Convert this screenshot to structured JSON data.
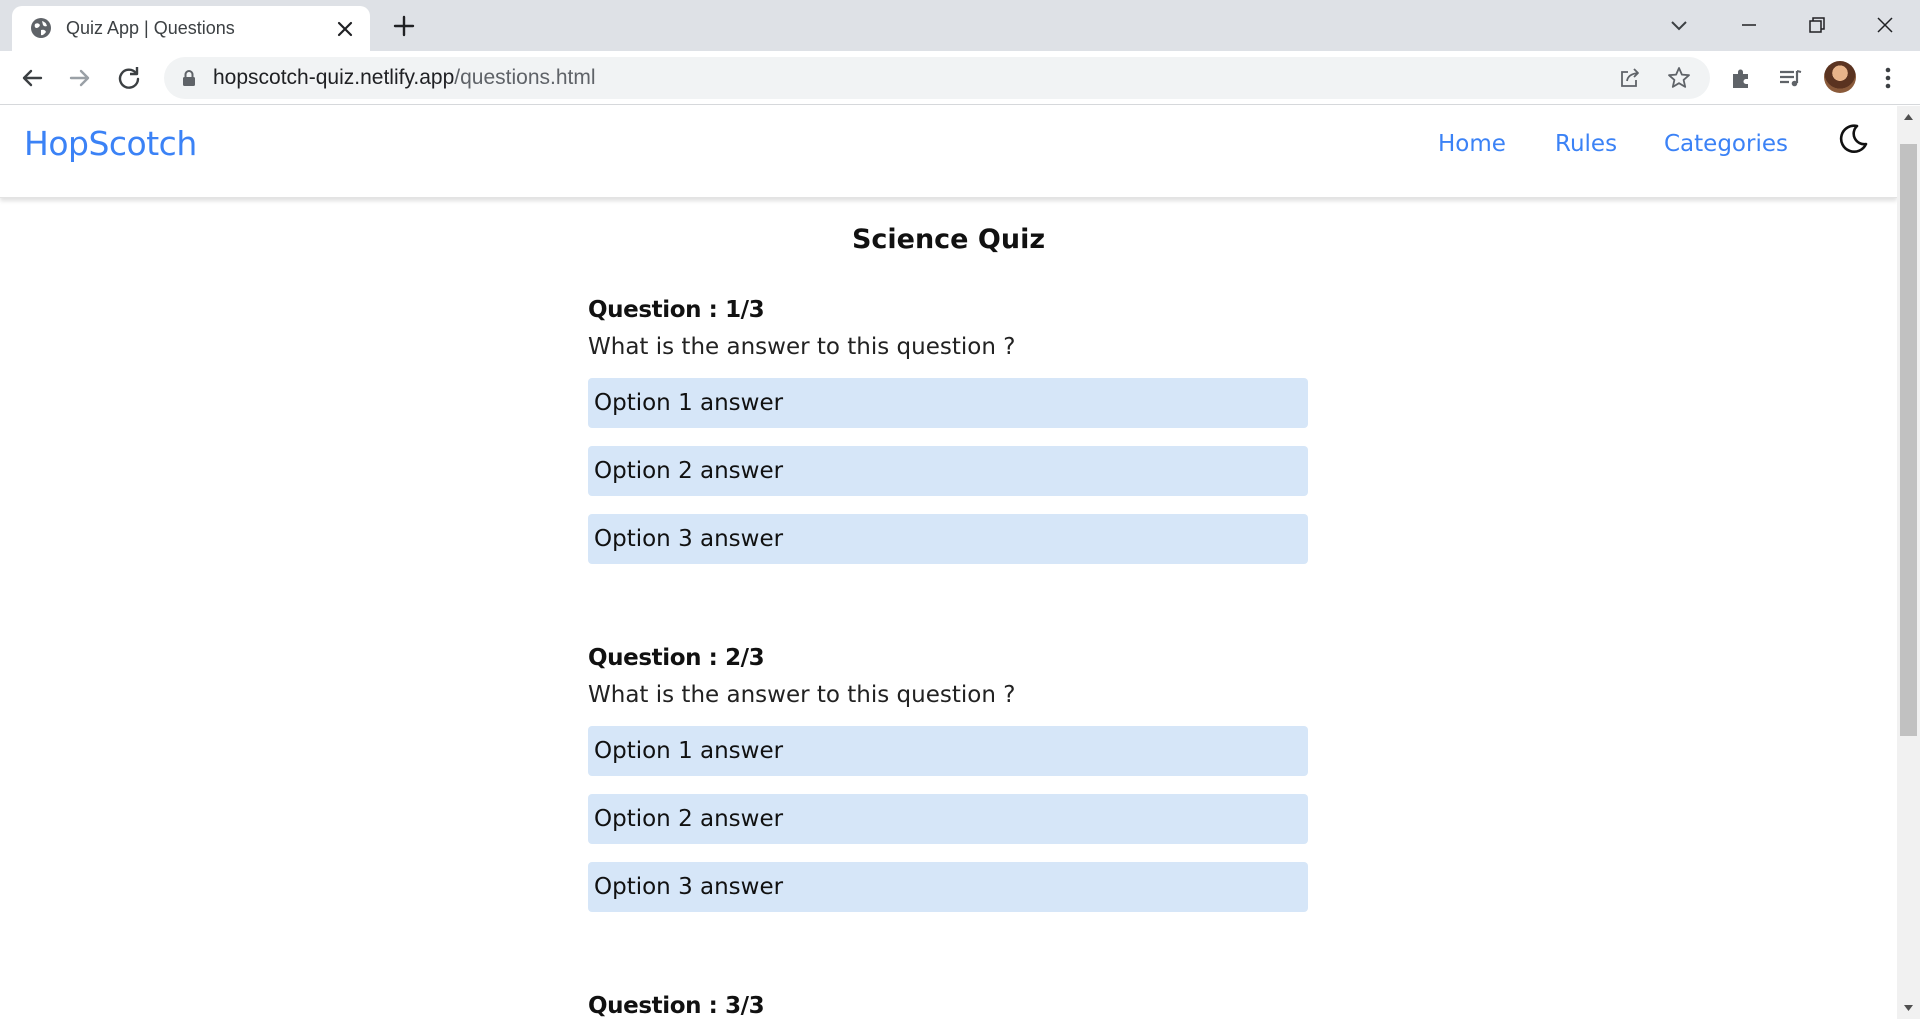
{
  "browser": {
    "tab_title": "Quiz App | Questions",
    "url_host": "hopscotch-quiz.netlify.app",
    "url_path": "/questions.html"
  },
  "icons": {
    "favicon": "globe-icon",
    "close_tab": "close-icon",
    "new_tab": "plus-icon",
    "back": "arrow-left-icon",
    "forward": "arrow-right-icon",
    "reload": "reload-icon",
    "lock": "lock-icon",
    "share": "share-icon",
    "bookmark": "star-icon",
    "extensions": "puzzle-icon",
    "media": "media-queue-icon",
    "menu": "kebab-menu-icon",
    "theme": "moon-icon"
  },
  "colors": {
    "brand": "#3b82f6",
    "option_bg": "#d6e6f8"
  },
  "nav": {
    "brand": "HopScotch",
    "links": [
      "Home",
      "Rules",
      "Categories"
    ]
  },
  "quiz": {
    "title": "Science Quiz",
    "questions": [
      {
        "heading": "Question : 1/3",
        "text": "What is the answer to this question ?",
        "options": [
          "Option 1 answer",
          "Option 2 answer",
          "Option 3 answer"
        ]
      },
      {
        "heading": "Question : 2/3",
        "text": "What is the answer to this question ?",
        "options": [
          "Option 1 answer",
          "Option 2 answer",
          "Option 3 answer"
        ]
      },
      {
        "heading": "Question : 3/3"
      }
    ]
  }
}
